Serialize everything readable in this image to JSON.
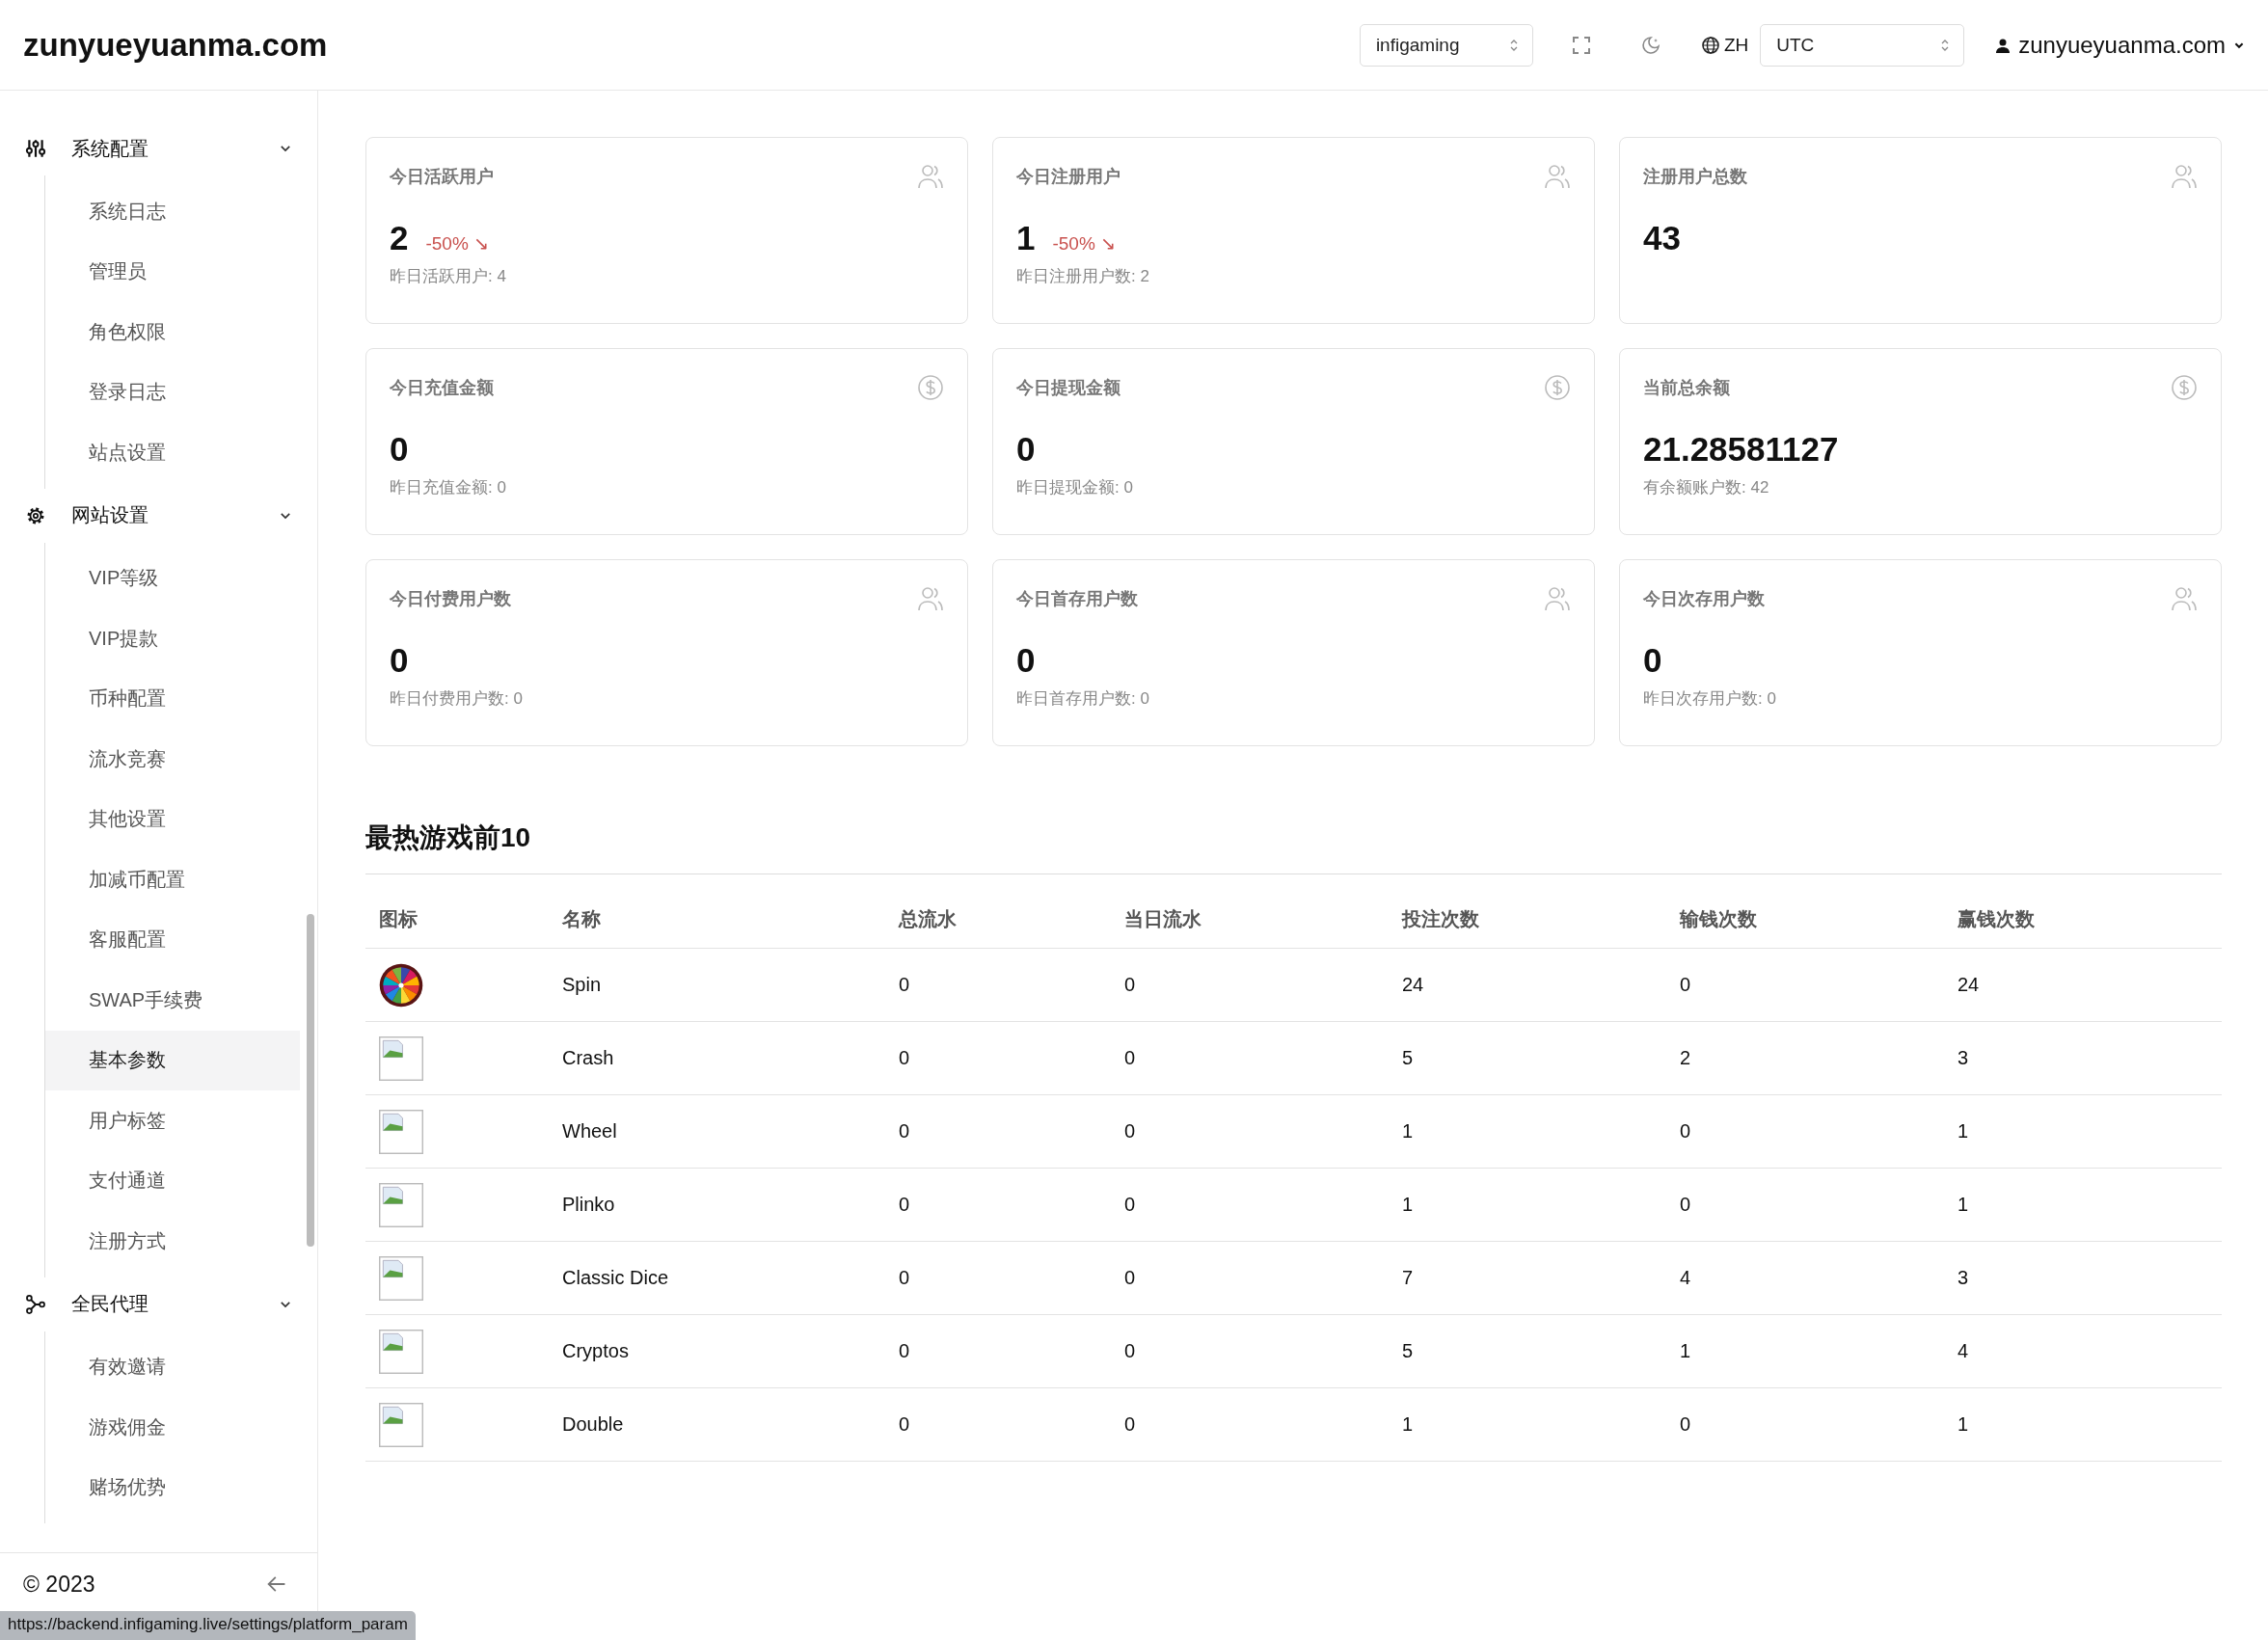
{
  "header": {
    "logo": "zunyueyuanma.com",
    "site_select": {
      "value": "infigaming"
    },
    "language": "ZH",
    "timezone_select": {
      "value": "UTC"
    },
    "user": "zunyueyuanma.com"
  },
  "sidebar": {
    "groups": [
      {
        "title": "系统配置",
        "kind": "sliders",
        "expanded": true,
        "items": [
          {
            "label": "系统日志",
            "selected": false
          },
          {
            "label": "管理员",
            "selected": false
          },
          {
            "label": "角色权限",
            "selected": false
          },
          {
            "label": "登录日志",
            "selected": false
          },
          {
            "label": "站点设置",
            "selected": false
          }
        ]
      },
      {
        "title": "网站设置",
        "kind": "gear",
        "expanded": true,
        "items": [
          {
            "label": "VIP等级",
            "selected": false
          },
          {
            "label": "VIP提款",
            "selected": false
          },
          {
            "label": "币种配置",
            "selected": false
          },
          {
            "label": "流水竞赛",
            "selected": false
          },
          {
            "label": "其他设置",
            "selected": false
          },
          {
            "label": "加减币配置",
            "selected": false
          },
          {
            "label": "客服配置",
            "selected": false
          },
          {
            "label": "SWAP手续费",
            "selected": false
          },
          {
            "label": "基本参数",
            "selected": true
          },
          {
            "label": "用户标签",
            "selected": false
          },
          {
            "label": "支付通道",
            "selected": false
          },
          {
            "label": "注册方式",
            "selected": false
          }
        ]
      },
      {
        "title": "全民代理",
        "kind": "network",
        "expanded": true,
        "items": [
          {
            "label": "有效邀请",
            "selected": false
          },
          {
            "label": "游戏佣金",
            "selected": false
          },
          {
            "label": "赌场优势",
            "selected": false
          }
        ]
      }
    ],
    "copyright": "© 2023"
  },
  "cards": [
    {
      "title": "今日活跃用户",
      "kind": "users",
      "value": "2",
      "change": "-50% ↘",
      "note": "昨日活跃用户: 4"
    },
    {
      "title": "今日注册用户",
      "kind": "users",
      "value": "1",
      "change": "-50% ↘",
      "note": "昨日注册用户数: 2"
    },
    {
      "title": "注册用户总数",
      "kind": "users",
      "value": "43"
    },
    {
      "title": "今日充值金额",
      "kind": "dollar",
      "value": "0",
      "note": "昨日充值金额: 0"
    },
    {
      "title": "今日提现金额",
      "kind": "dollar",
      "value": "0",
      "note": "昨日提现金额: 0"
    },
    {
      "title": "当前总余额",
      "kind": "dollar",
      "value": "21.28581127",
      "note": "有余额账户数: 42"
    },
    {
      "title": "今日付费用户数",
      "kind": "users",
      "value": "0",
      "note": "昨日付费用户数: 0"
    },
    {
      "title": "今日首存用户数",
      "kind": "users",
      "value": "0",
      "note": "昨日首存用户数: 0"
    },
    {
      "title": "今日次存用户数",
      "kind": "users",
      "value": "0",
      "note": "昨日次存用户数: 0"
    }
  ],
  "top_games": {
    "title": "最热游戏前10",
    "icon_column": "图标",
    "columns": [
      "名称",
      "总流水",
      "当日流水",
      "投注次数",
      "输钱次数",
      "赢钱次数"
    ],
    "rows": [
      {
        "kind": "wheel",
        "cells": [
          "Spin",
          "0",
          "0",
          "24",
          "0",
          "24"
        ]
      },
      {
        "kind": "broken",
        "cells": [
          "Crash",
          "0",
          "0",
          "5",
          "2",
          "3"
        ]
      },
      {
        "kind": "broken",
        "cells": [
          "Wheel",
          "0",
          "0",
          "1",
          "0",
          "1"
        ]
      },
      {
        "kind": "broken",
        "cells": [
          "Plinko",
          "0",
          "0",
          "1",
          "0",
          "1"
        ]
      },
      {
        "kind": "broken",
        "cells": [
          "Classic Dice",
          "0",
          "0",
          "7",
          "4",
          "3"
        ]
      },
      {
        "kind": "broken",
        "cells": [
          "Cryptos",
          "0",
          "0",
          "5",
          "1",
          "4"
        ]
      },
      {
        "kind": "broken",
        "cells": [
          "Double",
          "0",
          "0",
          "1",
          "0",
          "1"
        ]
      }
    ]
  },
  "status_url": "https://backend.infigaming.live/settings/platform_param"
}
